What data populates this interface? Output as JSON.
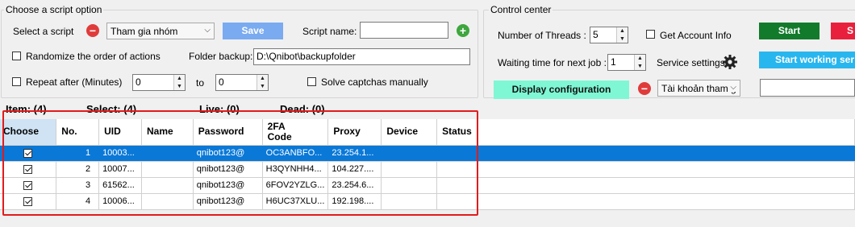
{
  "script_option": {
    "title": "Choose a script option",
    "select_script_label": "Select a script",
    "selected_script": "Tham gia nhóm",
    "save_label": "Save",
    "script_name_label": "Script name:",
    "script_name_value": "",
    "randomize_label": "Randomize the order of actions",
    "folder_backup_label": "Folder backup:",
    "folder_backup_value": "D:\\Qnibot\\backupfolder",
    "repeat_label": "Repeat after (Minutes)",
    "repeat_from": "0",
    "to_label": "to",
    "repeat_to": "0",
    "solve_captcha_label": "Solve captchas manually"
  },
  "control_center": {
    "title": "Control center",
    "threads_label": "Number of Threads :",
    "threads_value": "5",
    "get_account_info_label": "Get Account Info",
    "start_label": "Start",
    "stop_label": "S",
    "wait_label": "Waiting time for next job :",
    "wait_value": "1",
    "service_settings_label": "Service settings",
    "start_working_label": "Start working ser",
    "display_config_label": "Display configuration",
    "account_combo_value": "Tài khoản tham g",
    "colors": {
      "start": "#127a2b",
      "stop": "#e8203d",
      "start_working": "#28b6ee",
      "display_config": "#7ff7d4"
    }
  },
  "stats": {
    "item": "Item: (4)",
    "select": "Select: (4)",
    "live": "Live: (0)",
    "dead": "Dead: (0)"
  },
  "table": {
    "columns": [
      "Choose",
      "No.",
      "UID",
      "Name",
      "Password",
      "2FA\nCode",
      "Proxy",
      "Device",
      "Status"
    ],
    "rows": [
      {
        "checked": true,
        "no": "1",
        "uid": "10003...",
        "name": "",
        "password": "qnibot123@",
        "code": "OC3ANBFO...",
        "proxy": "23.254.1...",
        "device": "",
        "status": ""
      },
      {
        "checked": true,
        "no": "2",
        "uid": "10007...",
        "name": "",
        "password": "qnibot123@",
        "code": "H3QYNHH4...",
        "proxy": "104.227....",
        "device": "",
        "status": ""
      },
      {
        "checked": true,
        "no": "3",
        "uid": "61562...",
        "name": "",
        "password": "qnibot123@",
        "code": "6FOV2YZLG...",
        "proxy": "23.254.6...",
        "device": "",
        "status": ""
      },
      {
        "checked": true,
        "no": "4",
        "uid": "10006...",
        "name": "",
        "password": "qnibot123@",
        "code": "H6UC37XLU...",
        "proxy": "192.198....",
        "device": "",
        "status": ""
      }
    ],
    "selected_row": 0
  }
}
